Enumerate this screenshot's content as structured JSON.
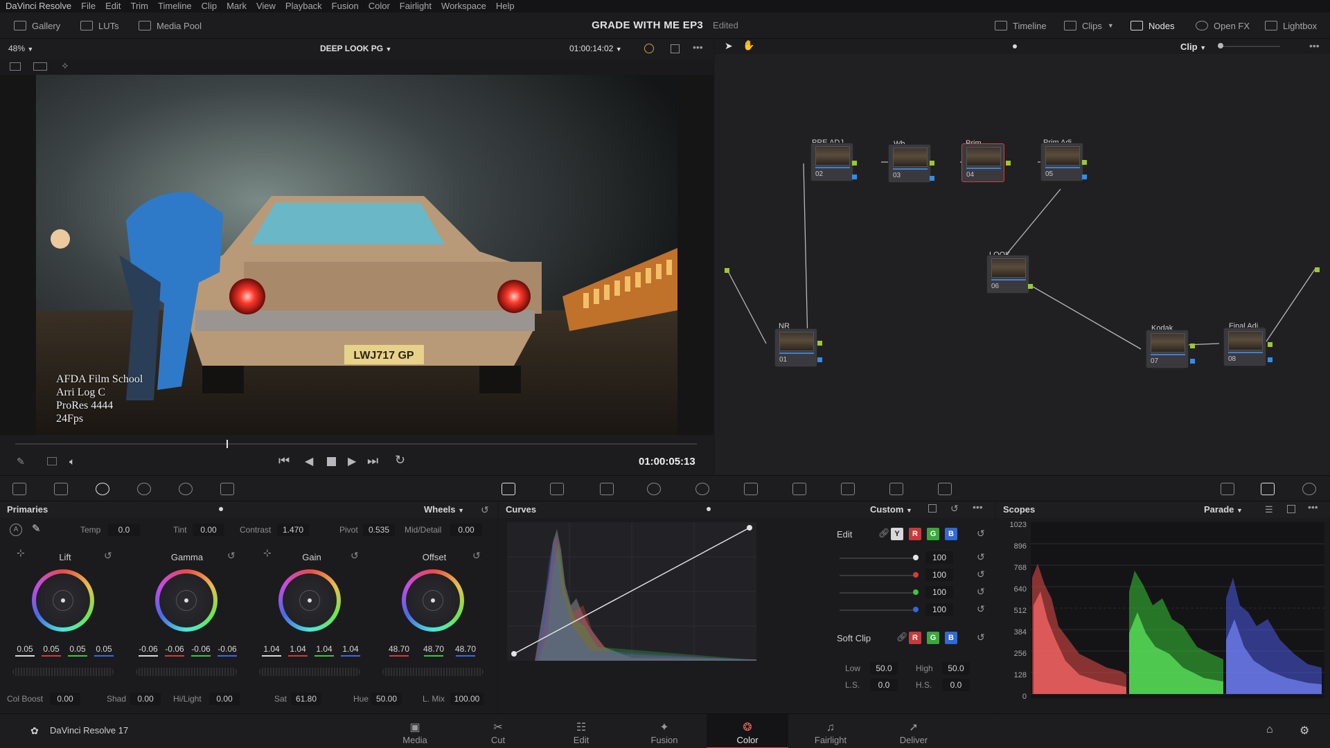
{
  "menu": [
    "DaVinci Resolve",
    "File",
    "Edit",
    "Trim",
    "Timeline",
    "Clip",
    "Mark",
    "View",
    "Playback",
    "Fusion",
    "Color",
    "Fairlight",
    "Workspace",
    "Help"
  ],
  "toolbar": {
    "gallery": "Gallery",
    "luts": "LUTs",
    "media_pool": "Media Pool",
    "project_title": "GRADE WITH ME EP3",
    "project_status": "Edited",
    "timeline": "Timeline",
    "clips": "Clips",
    "nodes": "Nodes",
    "openfx": "Open FX",
    "lightbox": "Lightbox"
  },
  "viewer": {
    "zoom": "48%",
    "clip_name": "DEEP LOOK PG",
    "timecode_top": "01:00:14:02",
    "burnin": [
      "AFDA Film School",
      "Arri Log C",
      "ProRes 4444",
      "24Fps"
    ],
    "timecode": "01:00:05:13",
    "playhead_fraction": 0.31
  },
  "nodes": {
    "mode": "Clip",
    "items": [
      {
        "label": "PRE ADJ",
        "num": "02"
      },
      {
        "label": "Wb",
        "num": "03"
      },
      {
        "label": "Prim",
        "num": "04"
      },
      {
        "label": "Prim Adj",
        "num": "05"
      },
      {
        "label": "LOOK",
        "num": "06"
      },
      {
        "label": "NR",
        "num": "01"
      },
      {
        "label": "Kodak",
        "num": "07"
      },
      {
        "label": "Final Adj...",
        "num": "08"
      }
    ]
  },
  "primaries": {
    "title": "Primaries",
    "mode": "Wheels",
    "temp_label": "Temp",
    "temp": "0.0",
    "tint_label": "Tint",
    "tint": "0.00",
    "contrast_label": "Contrast",
    "contrast": "1.470",
    "pivot_label": "Pivot",
    "pivot": "0.535",
    "middetail_label": "Mid/Detail",
    "middetail": "0.00",
    "wheels": [
      {
        "name": "Lift",
        "values": [
          "0.05",
          "0.05",
          "0.05",
          "0.05"
        ]
      },
      {
        "name": "Gamma",
        "values": [
          "-0.06",
          "-0.06",
          "-0.06",
          "-0.06"
        ]
      },
      {
        "name": "Gain",
        "values": [
          "1.04",
          "1.04",
          "1.04",
          "1.04"
        ]
      },
      {
        "name": "Offset",
        "values": [
          "48.70",
          "48.70",
          "48.70"
        ]
      }
    ],
    "colboost_label": "Col Boost",
    "colboost": "0.00",
    "shad_label": "Shad",
    "shad": "0.00",
    "hilight_label": "Hi/Light",
    "hilight": "0.00",
    "sat_label": "Sat",
    "sat": "61.80",
    "hue_label": "Hue",
    "hue": "50.00",
    "lmix_label": "L. Mix",
    "lmix": "100.00"
  },
  "curves": {
    "title": "Curves",
    "mode": "Custom",
    "edit_label": "Edit",
    "channels": [
      "Y",
      "R",
      "G",
      "B"
    ],
    "intensities": [
      "100",
      "100",
      "100",
      "100"
    ],
    "softclip_label": "Soft Clip",
    "low_label": "Low",
    "low": "50.0",
    "high_label": "High",
    "high": "50.0",
    "ls_label": "L.S.",
    "ls": "0.0",
    "hs_label": "H.S.",
    "hs": "0.0"
  },
  "scopes": {
    "title": "Scopes",
    "mode": "Parade",
    "ticks": [
      "1023",
      "896",
      "768",
      "640",
      "512",
      "384",
      "256",
      "128",
      "0"
    ]
  },
  "pages": {
    "app": "DaVinci Resolve 17",
    "tabs": [
      "Media",
      "Cut",
      "Edit",
      "Fusion",
      "Color",
      "Fairlight",
      "Deliver"
    ],
    "active": "Color"
  },
  "colors": {
    "accent": "#d8493a",
    "node_green": "#9ac832",
    "node_blue": "#2f8fe8"
  }
}
